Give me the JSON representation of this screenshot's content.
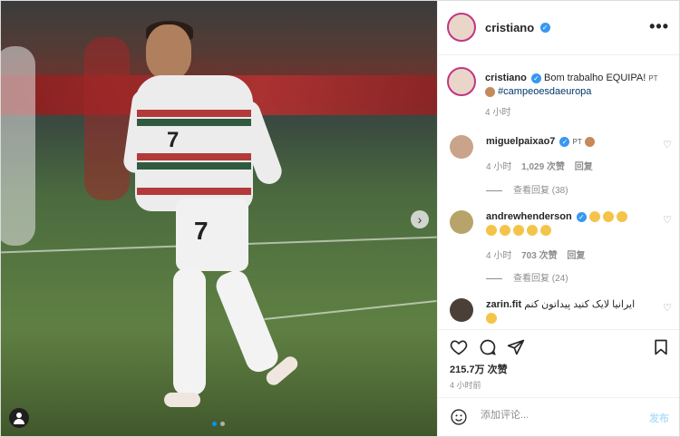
{
  "post": {
    "username": "cristiano",
    "more_label": "•••",
    "carousel_next": "›",
    "caption": {
      "username": "cristiano",
      "text": "Bom trabalho EQUIPA!",
      "flag": "PT",
      "hashtag": "#campeoesdaeuropa",
      "time": "4 小时"
    },
    "comments": [
      {
        "username": "miguelpaixao7",
        "text": "PT",
        "time": "4 小时",
        "likes": "1,029 次赞",
        "reply": "回复",
        "view_replies": "查看回复 (38)"
      },
      {
        "username": "andrewhenderson",
        "time": "4 小时",
        "likes": "703 次赞",
        "reply": "回复",
        "view_replies": "查看回复 (24)"
      },
      {
        "username": "zarin.fit",
        "text": "ایرانیا لایک کنید پیداتون کنم"
      }
    ],
    "likes_count": "215.7万 次赞",
    "posted_time": "4 小时前",
    "comment_placeholder": "添加评论...",
    "post_button": "发布",
    "jersey_number": "7"
  },
  "colors": {
    "accent": "#0095f6",
    "post_disabled": "#b2dffc",
    "verified": "#3897f0"
  },
  "icons": [
    "heart-icon",
    "comment-icon",
    "share-icon",
    "bookmark-icon",
    "emoji-icon",
    "verified-icon",
    "more-icon",
    "tag-user-icon"
  ]
}
